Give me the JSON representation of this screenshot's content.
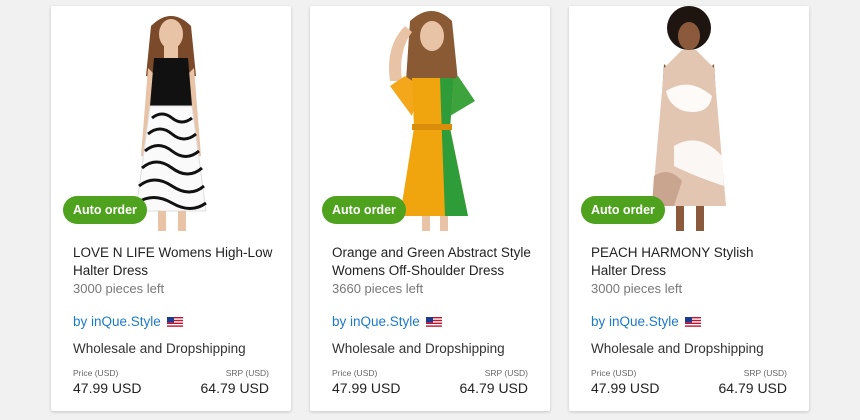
{
  "products": [
    {
      "badge": "Auto order",
      "title": "LOVE N LIFE Womens High-Low Halter Dress",
      "stock": "3000 pieces left",
      "seller": "by inQue.Style",
      "seller_flag": "us-flag-icon",
      "service": "Wholesale and Dropshipping",
      "price_label": "Price (USD)",
      "price": "47.99 USD",
      "srp_label": "SRP (USD)",
      "srp": "64.79 USD"
    },
    {
      "badge": "Auto order",
      "title": "Orange and Green Abstract Style Womens Off-Shoulder Dress",
      "stock": "3660 pieces left",
      "seller": "by inQue.Style",
      "seller_flag": "us-flag-icon",
      "service": "Wholesale and Dropshipping",
      "price_label": "Price (USD)",
      "price": "47.99 USD",
      "srp_label": "SRP (USD)",
      "srp": "64.79 USD"
    },
    {
      "badge": "Auto order",
      "title": "PEACH HARMONY Stylish Halter Dress",
      "stock": "3000 pieces left",
      "seller": "by inQue.Style",
      "seller_flag": "us-flag-icon",
      "service": "Wholesale and Dropshipping",
      "price_label": "Price (USD)",
      "price": "47.99 USD",
      "srp_label": "SRP (USD)",
      "srp": "64.79 USD"
    }
  ],
  "colors": {
    "badge_green": "#4ea21e",
    "seller_link": "#1d7ac8",
    "background": "#f1f1f1"
  }
}
